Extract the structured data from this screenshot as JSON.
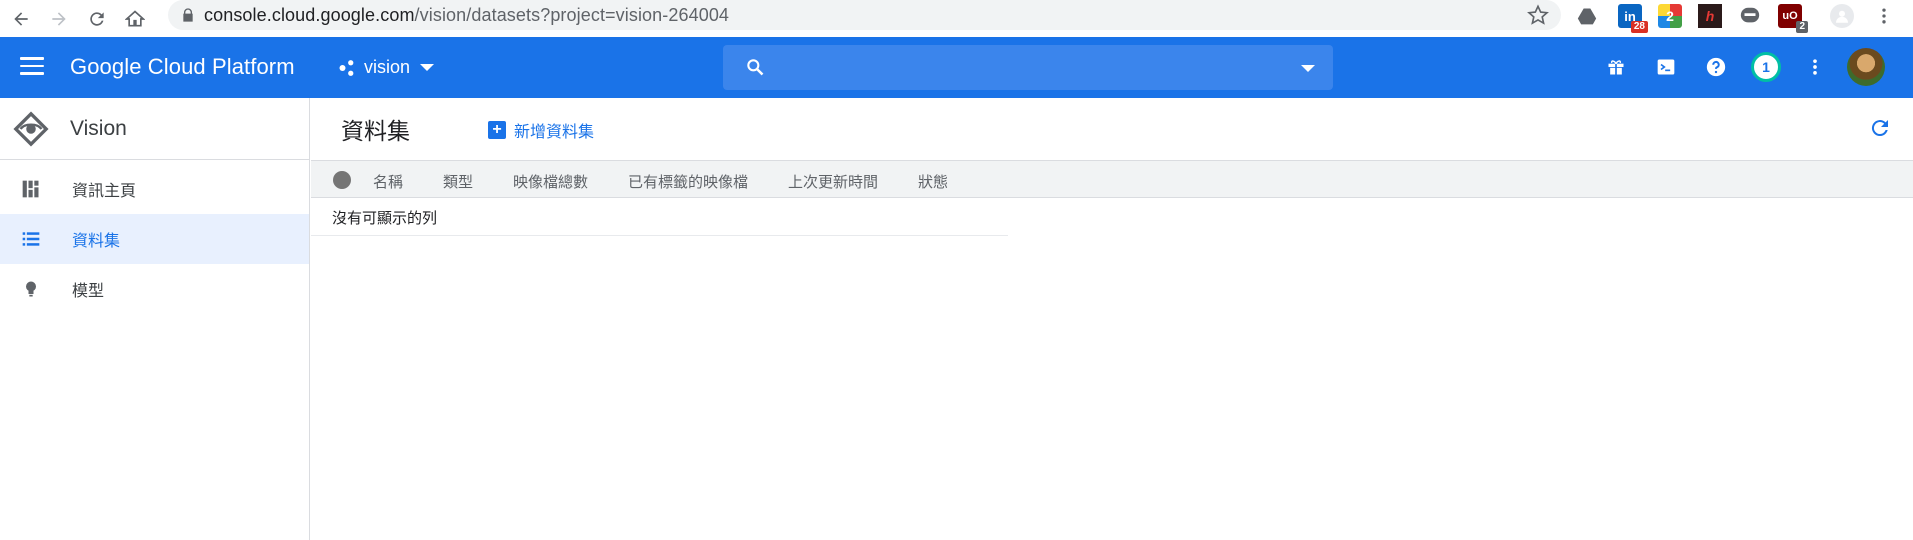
{
  "browser": {
    "url_host": "console.cloud.google.com",
    "url_path": "/vision/datasets?project=vision-264004",
    "extensions": [
      {
        "icon": "google-drive-icon",
        "badge": ""
      },
      {
        "icon": "linkedin-icon",
        "badge": "28",
        "badge_color": "#d93025"
      },
      {
        "icon": "extension-2-icon",
        "badge": ""
      },
      {
        "icon": "extension-h-icon",
        "badge": ""
      },
      {
        "icon": "line-icon",
        "badge": ""
      },
      {
        "icon": "ublock-icon",
        "badge": "2",
        "badge_color": "#5f6368"
      },
      {
        "icon": "profile-icon",
        "badge": ""
      }
    ]
  },
  "topbar": {
    "brand": "Google Cloud Platform",
    "project": "vision",
    "search_placeholder": "",
    "notification_count": "1",
    "colors": {
      "bar": "#1a73e8",
      "search": "#3b85ec",
      "notif_ring": "#00bfa5"
    }
  },
  "sidebar": {
    "title": "Vision",
    "items": [
      {
        "label": "資訊主頁",
        "icon": "dashboard-icon",
        "active": false
      },
      {
        "label": "資料集",
        "icon": "list-icon",
        "active": true
      },
      {
        "label": "模型",
        "icon": "lightbulb-icon",
        "active": false
      }
    ]
  },
  "main": {
    "title": "資料集",
    "create_label": "新增資料集",
    "columns": [
      "名稱",
      "類型",
      "映像檔總數",
      "已有標籤的映像檔",
      "上次更新時間",
      "狀態"
    ],
    "empty_message": "沒有可顯示的列"
  }
}
